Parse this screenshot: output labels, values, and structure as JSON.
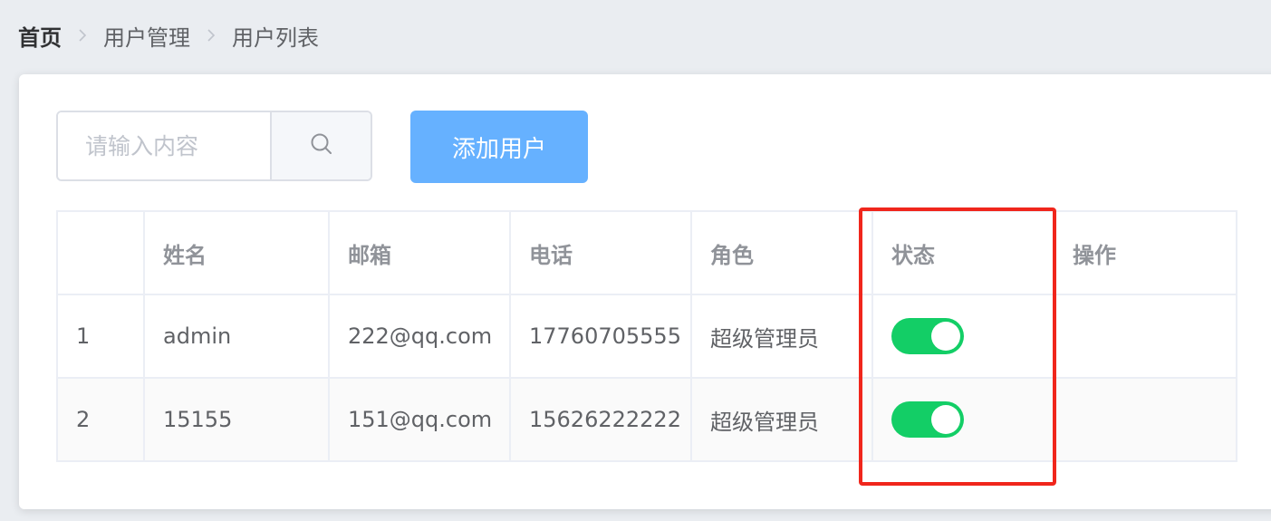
{
  "breadcrumb": {
    "items": [
      "首页",
      "用户管理",
      "用户列表"
    ]
  },
  "search": {
    "placeholder": "请输入内容",
    "value": ""
  },
  "toolbar": {
    "add_user_label": "添加用户"
  },
  "table": {
    "headers": [
      "",
      "姓名",
      "邮箱",
      "电话",
      "角色",
      "状态",
      "操作"
    ],
    "rows": [
      {
        "index": "1",
        "name": "admin",
        "email": "222@qq.com",
        "phone": "17760705555",
        "role": "超级管理员",
        "status_on": true
      },
      {
        "index": "2",
        "name": "15155",
        "email": "151@qq.com",
        "phone": "15626222222",
        "role": "超级管理员",
        "status_on": true
      }
    ]
  },
  "colors": {
    "switch_on": "#13ce66",
    "primary_button": "#66b1ff",
    "highlight": "#f0261c"
  },
  "icons": {
    "breadcrumb_separator": "chevron-right-icon",
    "search": "search-icon"
  }
}
